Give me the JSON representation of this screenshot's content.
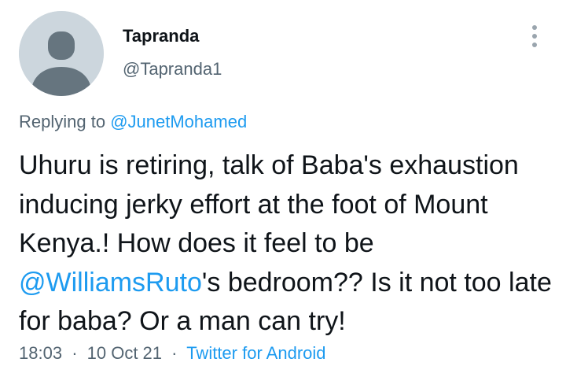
{
  "tweet": {
    "author": {
      "display_name": "Tapranda",
      "handle": "@Tapranda1",
      "avatar_icon": "default-avatar-silhouette-icon"
    },
    "more_icon": "more-vertical-icon",
    "replying": {
      "prefix": "Replying to",
      "mention": "@JunetMohamed"
    },
    "text": {
      "part1": "Uhuru is retiring, talk of Baba's exhaustion inducing jerky effort at the foot of Mount Kenya.! How does it feel to be ",
      "mention": "@WilliamsRuto",
      "part2": "'s bedroom?? Is it not too late for baba? Or a man can try!"
    },
    "meta": {
      "time": "18:03",
      "date": "10 Oct 21",
      "separator": "·",
      "source": "Twitter for Android"
    },
    "colors": {
      "link": "#1d9bf0",
      "secondary_text": "#536471",
      "primary_text": "#0f1419",
      "avatar_bg": "#ccd6dd"
    }
  }
}
